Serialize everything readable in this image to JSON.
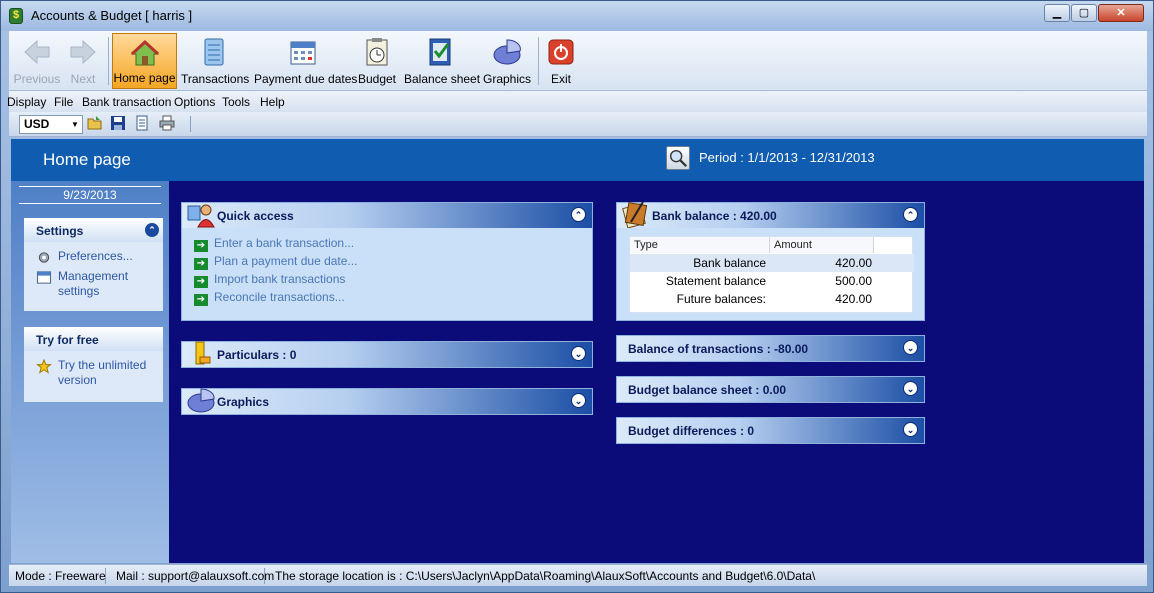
{
  "window": {
    "title": "Accounts & Budget [ harris ]",
    "controls": {
      "minimize": "▁",
      "maximize": "▢",
      "close": "✕"
    }
  },
  "toolbar": {
    "items": [
      {
        "label": "Previous",
        "icon": "arrow-left-icon",
        "enabled": false
      },
      {
        "label": "Next",
        "icon": "arrow-right-icon",
        "enabled": false
      },
      {
        "label": "Home page",
        "icon": "house-icon",
        "active": true
      },
      {
        "label": "Transactions",
        "icon": "notebook-icon"
      },
      {
        "label": "Payment due dates",
        "icon": "calendar-icon"
      },
      {
        "label": "Budget",
        "icon": "clipboard-clock-icon"
      },
      {
        "label": "Balance sheet",
        "icon": "checklist-icon"
      },
      {
        "label": "Graphics",
        "icon": "pie-chart-icon"
      },
      {
        "label": "Exit",
        "icon": "power-icon"
      }
    ]
  },
  "menu": [
    "Display",
    "File",
    "Bank transaction",
    "Options",
    "Tools",
    "Help"
  ],
  "toolbar2": {
    "currency": "USD",
    "icons": [
      "open-folder-icon",
      "save-icon",
      "document-icon",
      "printer-icon"
    ]
  },
  "header": {
    "title": "Home page",
    "period": "Period : 1/1/2013 - 12/31/2013"
  },
  "sidebar": {
    "date": "9/23/2013",
    "settings": {
      "title": "Settings",
      "links": [
        "Preferences...",
        "Management settings"
      ]
    },
    "try": {
      "title": "Try for free",
      "link": "Try the unlimited version"
    }
  },
  "quick_access": {
    "title": "Quick access",
    "links": [
      "Enter a bank transaction...",
      "Plan a payment due date...",
      "Import bank transactions",
      "Reconcile transactions..."
    ]
  },
  "particulars": {
    "title": "Particulars :  0"
  },
  "graphics": {
    "title": "Graphics"
  },
  "bank_balance": {
    "title": "Bank balance :  420.00",
    "columns": [
      "Type",
      "Amount"
    ],
    "rows": [
      {
        "type": "Bank balance",
        "amount": "420.00"
      },
      {
        "type": "Statement balance",
        "amount": "500.00"
      },
      {
        "type": "Future balances:",
        "amount": "420.00"
      }
    ]
  },
  "summaries": [
    "Balance of transactions : -80.00",
    "Budget balance sheet : 0.00",
    "Budget differences : 0"
  ],
  "status": {
    "mode": "Mode : Freeware",
    "mail": "Mail : support@alauxsoft.com",
    "storage": "The storage location is : C:\\Users\\Jaclyn\\AppData\\Roaming\\AlauxSoft\\Accounts and Budget\\6.0\\Data\\"
  }
}
